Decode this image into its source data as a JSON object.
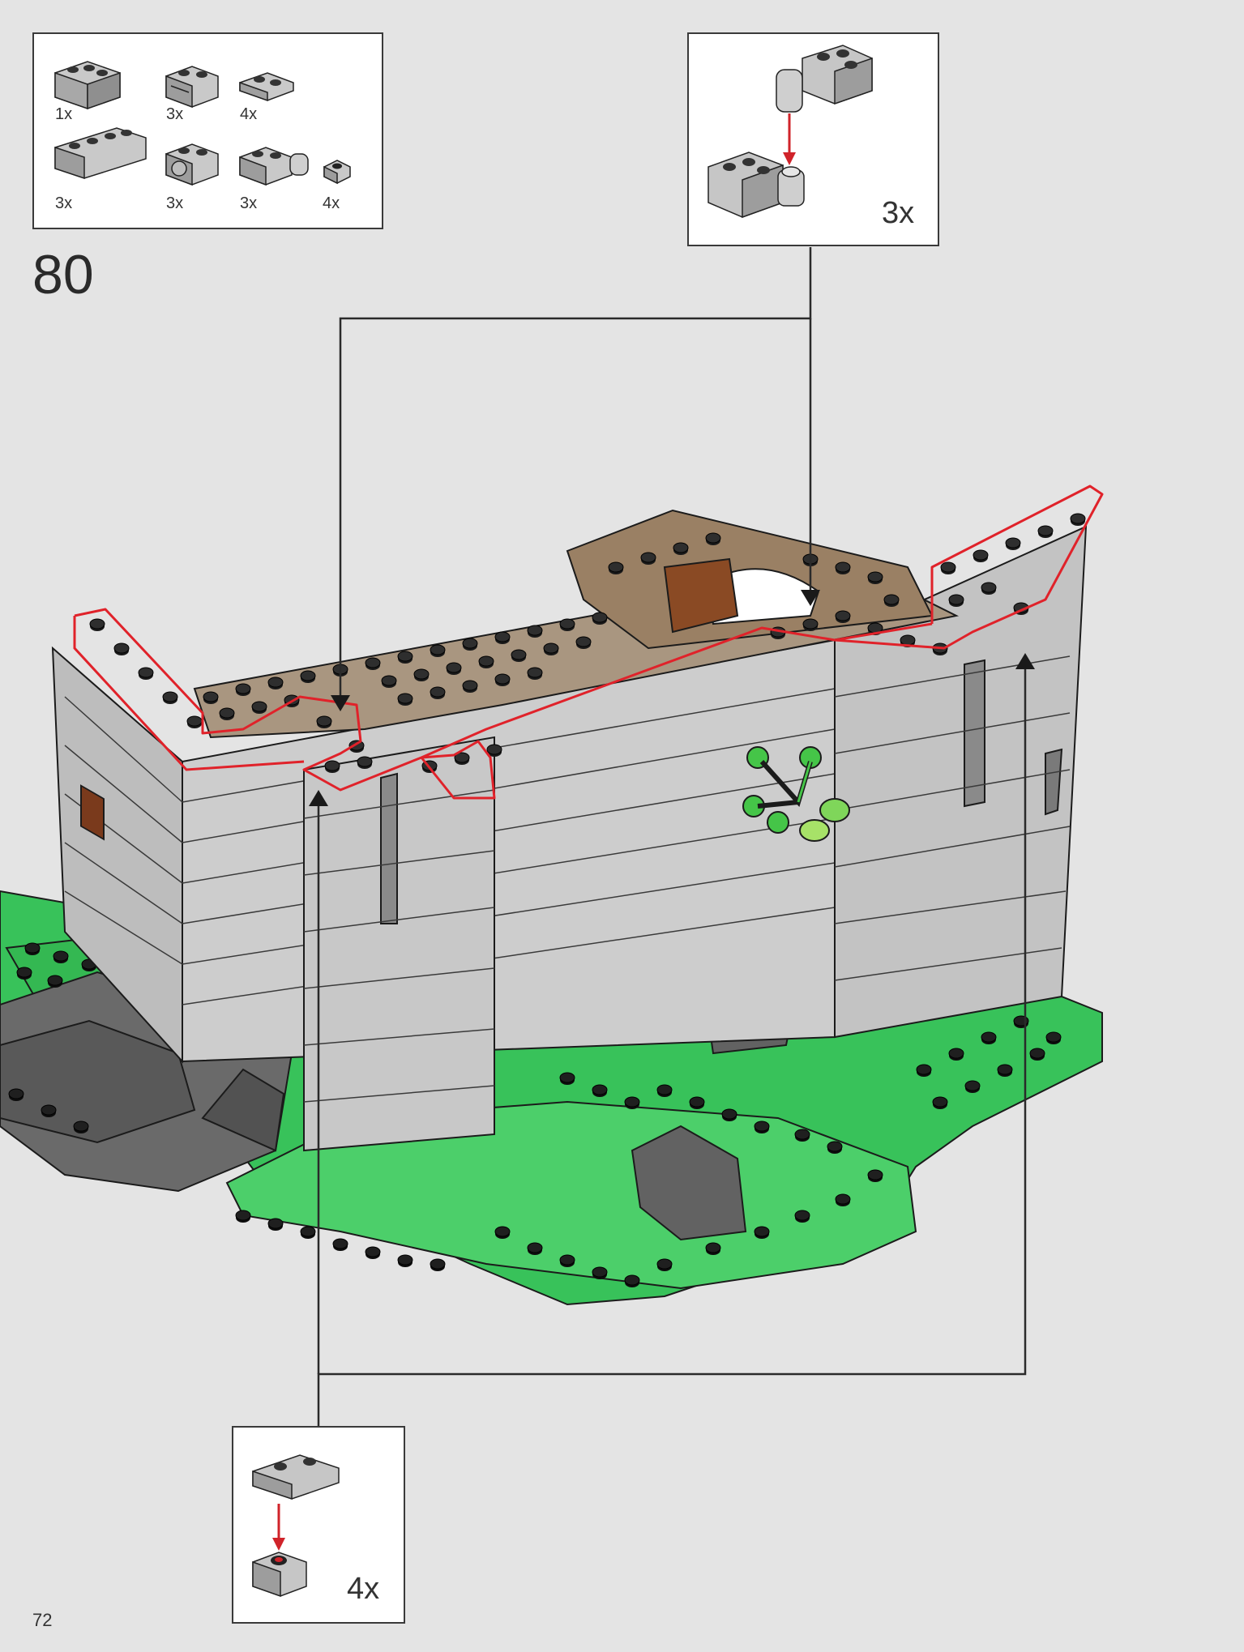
{
  "page": {
    "number": "72",
    "step": "80"
  },
  "parts_list": [
    {
      "name": "brick-corner-icon",
      "qty": "1x"
    },
    {
      "name": "brick-modified-1x2-icon",
      "qty": "3x"
    },
    {
      "name": "plate-1x2-icon",
      "qty": "4x"
    },
    {
      "name": "brick-1x4-icon",
      "qty": "3x"
    },
    {
      "name": "brick-clip-icon",
      "qty": "3x"
    },
    {
      "name": "plate-hinge-icon",
      "qty": "3x"
    },
    {
      "name": "round-plate-1x1-icon",
      "qty": "4x"
    }
  ],
  "callouts": {
    "top_right": {
      "qty": "3x"
    },
    "bottom": {
      "qty": "4x"
    }
  },
  "colors": {
    "background": "#e4e4e4",
    "brick_gray": "#c8c8c8",
    "brick_dark": "#6e6e6e",
    "green": "#3cc25a",
    "tan": "#9a8a72",
    "highlight_red": "#e0222a"
  }
}
